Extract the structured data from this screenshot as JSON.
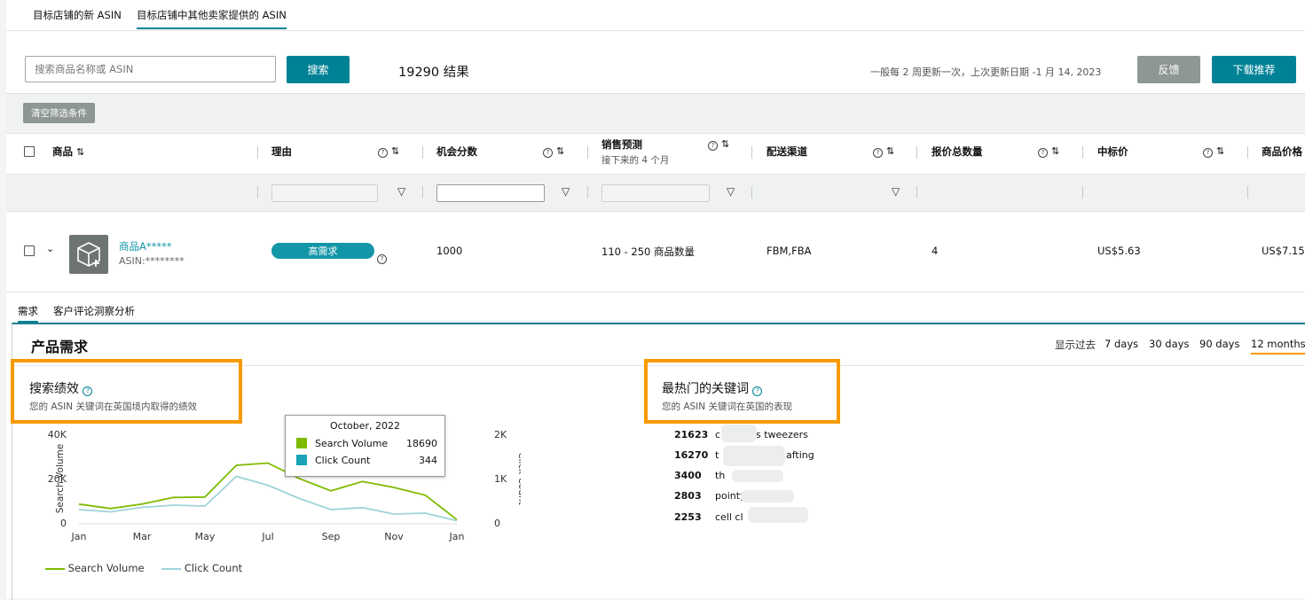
{
  "top_tabs": [
    "目标店铺的新 ASIN",
    "目标店铺中其他卖家提供的 ASIN"
  ],
  "search": {
    "placeholder": "搜索商品名称或 ASIN",
    "button": "搜索"
  },
  "results_text": "19290 结果",
  "update_note": "一般每 2 周更新一次，上次更新日期 -1 月 14, 2023",
  "feedback_button": "反馈",
  "download_button": "下载推荐",
  "clear_filters": "清空筛选条件",
  "columns": {
    "product": "商品",
    "reason": "理由",
    "opportunity": "机会分数",
    "sales_forecast": "销售预测",
    "sales_forecast_sub": "接下来的 4 个月",
    "channel": "配送渠道",
    "offers": "报价总数量",
    "buybox": "中标价",
    "price": "商品价格"
  },
  "row": {
    "product_name": "商品A*****",
    "asin": "ASIN:********",
    "reason_badge": "高需求",
    "opportunity": "1000",
    "forecast": "110 - 250 商品数量",
    "channel": "FBM,FBA",
    "offers": "4",
    "buybox": "US$5.63",
    "price": "US$7.15"
  },
  "sub_tabs": [
    "需求",
    "客户评论洞察分析"
  ],
  "panel": {
    "title": "产品需求",
    "show_past": "显示过去",
    "ranges": [
      "7 days",
      "30 days",
      "90 days",
      "12 months"
    ],
    "active_range": "12 months"
  },
  "search_perf": {
    "title": "搜索绩效",
    "subtitle": "您的 ASIN 关键词在英国境内取得的绩效"
  },
  "keywords": {
    "title": "最热门的关键词",
    "subtitle": "您的 ASIN 关键词在英国的表现",
    "items": [
      {
        "count": "21623",
        "text_start": "c",
        "text_end": "s tweezers"
      },
      {
        "count": "16270",
        "text_start": "t",
        "text_end": "afting"
      },
      {
        "count": "3400",
        "text_start": "th",
        "text_end": ""
      },
      {
        "count": "2803",
        "text_start": "pointy",
        "text_end": ""
      },
      {
        "count": "2253",
        "text_start": "cell cl",
        "text_end": ""
      }
    ]
  },
  "tooltip": {
    "date": "October, 2022",
    "rows": [
      {
        "label": "Search Volume",
        "value": "18690",
        "color": "#7fba00"
      },
      {
        "label": "Click Count",
        "value": "344",
        "color": "#1ba3b6"
      }
    ]
  },
  "chart_data": {
    "type": "line",
    "x": [
      "Jan",
      "Feb",
      "Mar",
      "Apr",
      "May",
      "Jun",
      "Jul",
      "Aug",
      "Sep",
      "Oct",
      "Nov",
      "Dec",
      "Jan"
    ],
    "x_ticks": [
      "Jan",
      "Mar",
      "May",
      "Jul",
      "Sep",
      "Nov",
      "Jan"
    ],
    "series": [
      {
        "name": "Search Volume",
        "axis": "left",
        "color": "#7fba00",
        "values": [
          8500,
          6500,
          8500,
          11500,
          11700,
          26000,
          27000,
          20000,
          14500,
          18690,
          16000,
          12500,
          1500
        ]
      },
      {
        "name": "Click Count",
        "axis": "left_scaled",
        "color": "#9fd3da",
        "values": [
          300,
          250,
          350,
          400,
          380,
          1050,
          850,
          550,
          300,
          344,
          200,
          220,
          50
        ]
      }
    ],
    "ylabel_left": "Search Volume",
    "ylabel_right": "Click Count",
    "ylim_left": [
      0,
      40000
    ],
    "ylim_right": [
      0,
      2000
    ],
    "yticks_left": [
      "0",
      "20K",
      "40K"
    ],
    "yticks_right": [
      "0",
      "1K",
      "2K"
    ],
    "legend": "bottom-left",
    "grid": false
  }
}
